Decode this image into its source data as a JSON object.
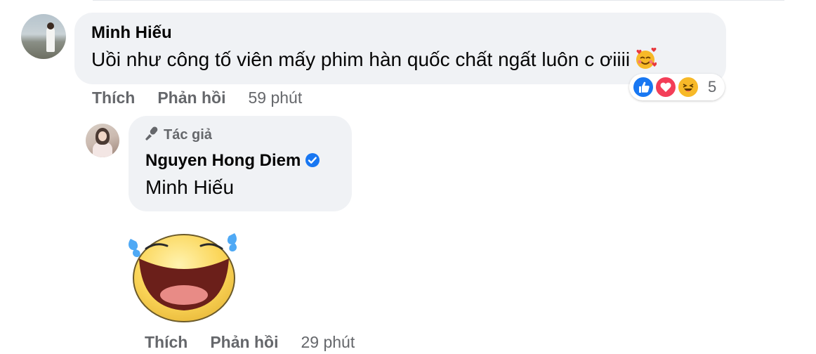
{
  "comment": {
    "author": "Minh Hiếu",
    "text": "Uồi như công tố viên mấy phim hàn quốc chất ngất luôn c ơiiii",
    "inline_emoji": "smiling-face-with-hearts-icon",
    "reactions": {
      "icons": [
        "like-icon",
        "love-icon",
        "haha-icon"
      ],
      "count": "5"
    },
    "actions": {
      "like": "Thích",
      "reply": "Phản hồi",
      "time": "59 phút"
    }
  },
  "reply": {
    "badge": "Tác giả",
    "author": "Nguyen Hong Diem",
    "verified": true,
    "mention": "Minh Hiếu",
    "sticker": "laughing-tears-sticker",
    "actions": {
      "like": "Thích",
      "reply": "Phản hồi",
      "time": "29 phút"
    }
  },
  "colors": {
    "bubble": "#f0f2f5",
    "secondary_text": "#65676b",
    "like_blue": "#1877f2",
    "love_red": "#f33e58",
    "haha_yellow": "#f7b928"
  }
}
